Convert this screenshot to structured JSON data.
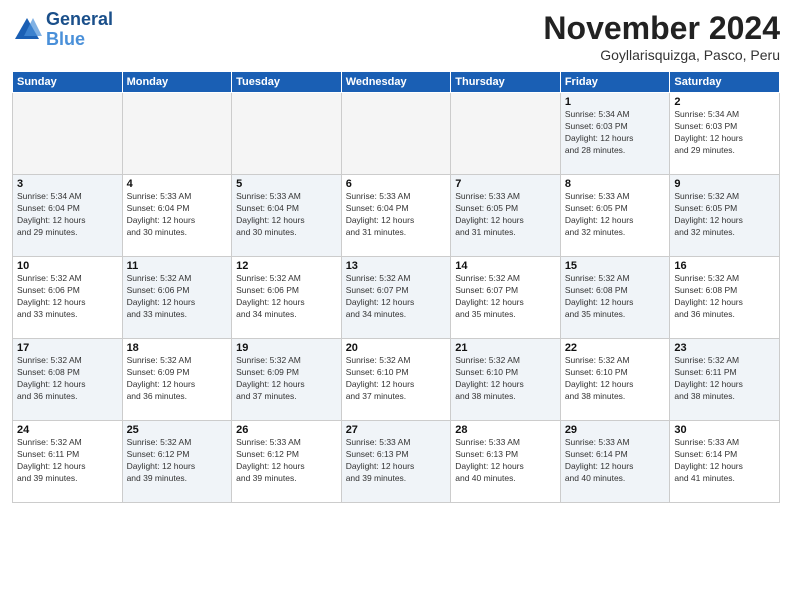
{
  "logo": {
    "text_general": "General",
    "text_blue": "Blue"
  },
  "title": "November 2024",
  "location": "Goyllarisquizga, Pasco, Peru",
  "days_of_week": [
    "Sunday",
    "Monday",
    "Tuesday",
    "Wednesday",
    "Thursday",
    "Friday",
    "Saturday"
  ],
  "weeks": [
    [
      {
        "day": "",
        "info": "",
        "empty": true
      },
      {
        "day": "",
        "info": "",
        "empty": true
      },
      {
        "day": "",
        "info": "",
        "empty": true
      },
      {
        "day": "",
        "info": "",
        "empty": true
      },
      {
        "day": "",
        "info": "",
        "empty": true
      },
      {
        "day": "1",
        "info": "Sunrise: 5:34 AM\nSunset: 6:03 PM\nDaylight: 12 hours\nand 28 minutes.",
        "shaded": true
      },
      {
        "day": "2",
        "info": "Sunrise: 5:34 AM\nSunset: 6:03 PM\nDaylight: 12 hours\nand 29 minutes.",
        "shaded": false
      }
    ],
    [
      {
        "day": "3",
        "info": "Sunrise: 5:34 AM\nSunset: 6:04 PM\nDaylight: 12 hours\nand 29 minutes.",
        "shaded": true
      },
      {
        "day": "4",
        "info": "Sunrise: 5:33 AM\nSunset: 6:04 PM\nDaylight: 12 hours\nand 30 minutes.",
        "shaded": false
      },
      {
        "day": "5",
        "info": "Sunrise: 5:33 AM\nSunset: 6:04 PM\nDaylight: 12 hours\nand 30 minutes.",
        "shaded": true
      },
      {
        "day": "6",
        "info": "Sunrise: 5:33 AM\nSunset: 6:04 PM\nDaylight: 12 hours\nand 31 minutes.",
        "shaded": false
      },
      {
        "day": "7",
        "info": "Sunrise: 5:33 AM\nSunset: 6:05 PM\nDaylight: 12 hours\nand 31 minutes.",
        "shaded": true
      },
      {
        "day": "8",
        "info": "Sunrise: 5:33 AM\nSunset: 6:05 PM\nDaylight: 12 hours\nand 32 minutes.",
        "shaded": false
      },
      {
        "day": "9",
        "info": "Sunrise: 5:32 AM\nSunset: 6:05 PM\nDaylight: 12 hours\nand 32 minutes.",
        "shaded": true
      }
    ],
    [
      {
        "day": "10",
        "info": "Sunrise: 5:32 AM\nSunset: 6:06 PM\nDaylight: 12 hours\nand 33 minutes.",
        "shaded": false
      },
      {
        "day": "11",
        "info": "Sunrise: 5:32 AM\nSunset: 6:06 PM\nDaylight: 12 hours\nand 33 minutes.",
        "shaded": true
      },
      {
        "day": "12",
        "info": "Sunrise: 5:32 AM\nSunset: 6:06 PM\nDaylight: 12 hours\nand 34 minutes.",
        "shaded": false
      },
      {
        "day": "13",
        "info": "Sunrise: 5:32 AM\nSunset: 6:07 PM\nDaylight: 12 hours\nand 34 minutes.",
        "shaded": true
      },
      {
        "day": "14",
        "info": "Sunrise: 5:32 AM\nSunset: 6:07 PM\nDaylight: 12 hours\nand 35 minutes.",
        "shaded": false
      },
      {
        "day": "15",
        "info": "Sunrise: 5:32 AM\nSunset: 6:08 PM\nDaylight: 12 hours\nand 35 minutes.",
        "shaded": true
      },
      {
        "day": "16",
        "info": "Sunrise: 5:32 AM\nSunset: 6:08 PM\nDaylight: 12 hours\nand 36 minutes.",
        "shaded": false
      }
    ],
    [
      {
        "day": "17",
        "info": "Sunrise: 5:32 AM\nSunset: 6:08 PM\nDaylight: 12 hours\nand 36 minutes.",
        "shaded": true
      },
      {
        "day": "18",
        "info": "Sunrise: 5:32 AM\nSunset: 6:09 PM\nDaylight: 12 hours\nand 36 minutes.",
        "shaded": false
      },
      {
        "day": "19",
        "info": "Sunrise: 5:32 AM\nSunset: 6:09 PM\nDaylight: 12 hours\nand 37 minutes.",
        "shaded": true
      },
      {
        "day": "20",
        "info": "Sunrise: 5:32 AM\nSunset: 6:10 PM\nDaylight: 12 hours\nand 37 minutes.",
        "shaded": false
      },
      {
        "day": "21",
        "info": "Sunrise: 5:32 AM\nSunset: 6:10 PM\nDaylight: 12 hours\nand 38 minutes.",
        "shaded": true
      },
      {
        "day": "22",
        "info": "Sunrise: 5:32 AM\nSunset: 6:10 PM\nDaylight: 12 hours\nand 38 minutes.",
        "shaded": false
      },
      {
        "day": "23",
        "info": "Sunrise: 5:32 AM\nSunset: 6:11 PM\nDaylight: 12 hours\nand 38 minutes.",
        "shaded": true
      }
    ],
    [
      {
        "day": "24",
        "info": "Sunrise: 5:32 AM\nSunset: 6:11 PM\nDaylight: 12 hours\nand 39 minutes.",
        "shaded": false
      },
      {
        "day": "25",
        "info": "Sunrise: 5:32 AM\nSunset: 6:12 PM\nDaylight: 12 hours\nand 39 minutes.",
        "shaded": true
      },
      {
        "day": "26",
        "info": "Sunrise: 5:33 AM\nSunset: 6:12 PM\nDaylight: 12 hours\nand 39 minutes.",
        "shaded": false
      },
      {
        "day": "27",
        "info": "Sunrise: 5:33 AM\nSunset: 6:13 PM\nDaylight: 12 hours\nand 39 minutes.",
        "shaded": true
      },
      {
        "day": "28",
        "info": "Sunrise: 5:33 AM\nSunset: 6:13 PM\nDaylight: 12 hours\nand 40 minutes.",
        "shaded": false
      },
      {
        "day": "29",
        "info": "Sunrise: 5:33 AM\nSunset: 6:14 PM\nDaylight: 12 hours\nand 40 minutes.",
        "shaded": true
      },
      {
        "day": "30",
        "info": "Sunrise: 5:33 AM\nSunset: 6:14 PM\nDaylight: 12 hours\nand 41 minutes.",
        "shaded": false
      }
    ]
  ]
}
